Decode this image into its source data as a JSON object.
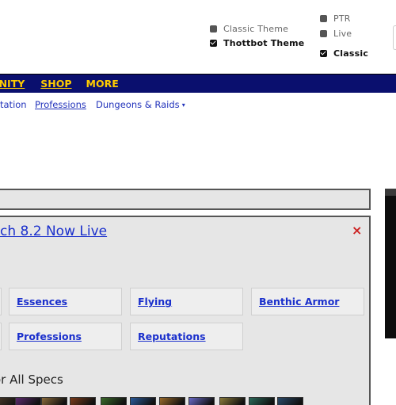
{
  "top_options": {
    "theme_left": [
      {
        "label": "Classic Theme",
        "checked": false
      },
      {
        "label": "Thottbot Theme",
        "checked": true
      }
    ],
    "realm_right": [
      {
        "label": "PTR",
        "checked": false
      },
      {
        "label": "Live",
        "checked": false
      },
      {
        "label": "Classic",
        "checked": true
      }
    ]
  },
  "navbar": {
    "items": [
      "MUNITY",
      "SHOP",
      "MORE"
    ],
    "background": "#0a0f6e",
    "text_color": "#ffcc00"
  },
  "subnav": {
    "items": [
      "tation",
      "Professions",
      "Dungeons & Raids"
    ],
    "caret": "▾"
  },
  "panel": {
    "title": "ch 8.2 Now Live",
    "close_glyph": "×",
    "tiles_row1": [
      "Essences",
      "Flying",
      "Benthic Armor"
    ],
    "tiles_row2": [
      "Professions",
      "Reputations"
    ],
    "specs_heading": "or All Specs",
    "spec_icon_colors": [
      "#4a3a2a",
      "#5c2a6e",
      "#8a6a3a",
      "#7a3a1a",
      "#3a6a2a",
      "#2a5a9a",
      "#9a6a2a",
      "#6a6ac8",
      "#8a7a3a",
      "#2a6a5a",
      "#2a4a6a"
    ]
  },
  "colors": {
    "link": "#1a2fcc",
    "panel_bg": "#e6e6e6",
    "close": "#cc2222"
  }
}
